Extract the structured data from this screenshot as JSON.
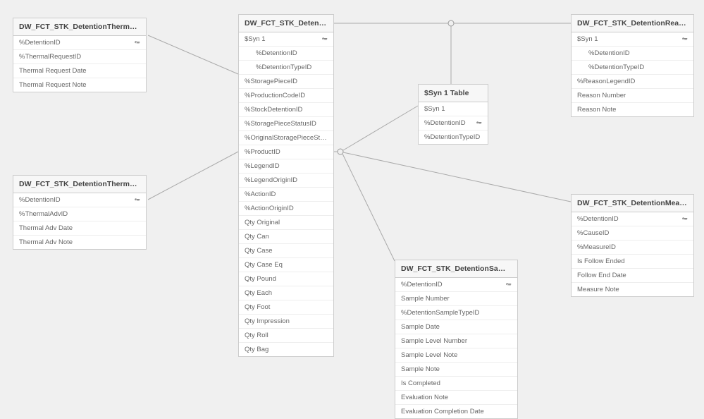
{
  "tables": {
    "thermalReq": {
      "title": "DW_FCT_STK_DetentionThermalRequest_Transform",
      "fields": [
        {
          "name": "%DetentionID",
          "key": true
        },
        {
          "name": "%ThermalRequestID"
        },
        {
          "name": "Thermal Request Date"
        },
        {
          "name": "Thermal Request Note"
        }
      ]
    },
    "thermalAdv": {
      "title": "DW_FCT_STK_DetentionThermalAdv_Transform",
      "fields": [
        {
          "name": "%DetentionID",
          "key": true
        },
        {
          "name": "%ThermalAdvID"
        },
        {
          "name": "Thermal Adv Date"
        },
        {
          "name": "Thermal Adv Note"
        }
      ]
    },
    "detention": {
      "title": "DW_FCT_STK_Detention_Transform",
      "fields": [
        {
          "name": "$Syn 1",
          "key": true
        },
        {
          "name": "%DetentionID",
          "indent": true
        },
        {
          "name": "%DetentionTypeID",
          "indent": true
        },
        {
          "name": "%StoragePieceID"
        },
        {
          "name": "%ProductionCodeID"
        },
        {
          "name": "%StockDetentionID"
        },
        {
          "name": "%StoragePieceStatusID"
        },
        {
          "name": "%OriginalStoragePieceStatusID"
        },
        {
          "name": "%ProductID"
        },
        {
          "name": "%LegendID"
        },
        {
          "name": "%LegendOriginID"
        },
        {
          "name": "%ActionID"
        },
        {
          "name": "%ActionOriginID"
        },
        {
          "name": "Qty Original"
        },
        {
          "name": "Qty Can"
        },
        {
          "name": "Qty Case"
        },
        {
          "name": "Qty Case Eq"
        },
        {
          "name": "Qty Pound"
        },
        {
          "name": "Qty Each"
        },
        {
          "name": "Qty Foot"
        },
        {
          "name": "Qty Impression"
        },
        {
          "name": "Qty Roll"
        },
        {
          "name": "Qty Bag"
        }
      ]
    },
    "syn1": {
      "title": "$Syn 1 Table",
      "fields": [
        {
          "name": "$Syn 1"
        },
        {
          "name": "%DetentionID",
          "key": true
        },
        {
          "name": "%DetentionTypeID"
        }
      ]
    },
    "reason": {
      "title": "DW_FCT_STK_DetentionReason_Transfo...",
      "fields": [
        {
          "name": "$Syn 1",
          "key": true
        },
        {
          "name": "%DetentionID",
          "indent": true
        },
        {
          "name": "%DetentionTypeID",
          "indent": true
        },
        {
          "name": "%ReasonLegendID"
        },
        {
          "name": "Reason Number"
        },
        {
          "name": "Reason Note"
        }
      ]
    },
    "sample": {
      "title": "DW_FCT_STK_DetentionSample_Transform",
      "fields": [
        {
          "name": "%DetentionID",
          "key": true
        },
        {
          "name": "Sample Number"
        },
        {
          "name": "%DetentionSampleTypeID"
        },
        {
          "name": "Sample Date"
        },
        {
          "name": "Sample Level Number"
        },
        {
          "name": "Sample Level Note"
        },
        {
          "name": "Sample Note"
        },
        {
          "name": "Is Completed"
        },
        {
          "name": "Evaluation Note"
        },
        {
          "name": "Evaluation Completion Date"
        }
      ]
    },
    "measure": {
      "title": "DW_FCT_STK_DetentionMeasure_Transform",
      "fields": [
        {
          "name": "%DetentionID",
          "key": true
        },
        {
          "name": "%CauseID"
        },
        {
          "name": "%MeasureID"
        },
        {
          "name": "Is Follow Ended"
        },
        {
          "name": "Follow End Date"
        },
        {
          "name": "Measure Note"
        }
      ]
    }
  }
}
